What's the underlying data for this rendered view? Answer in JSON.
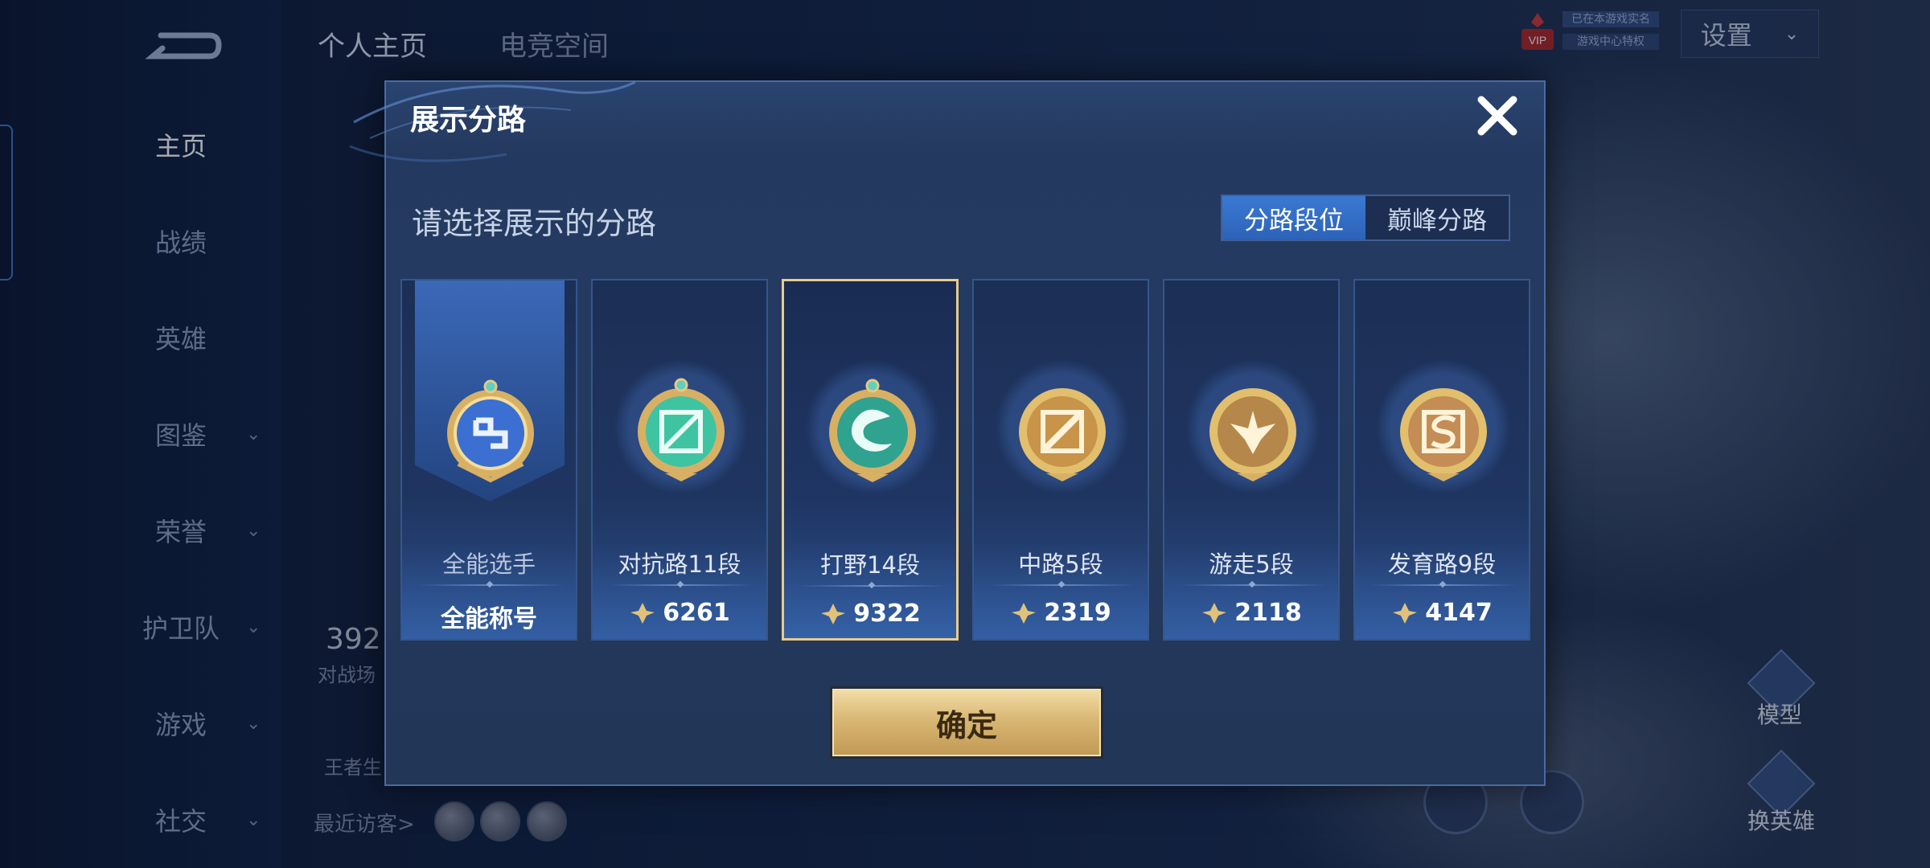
{
  "background": {
    "tabs": [
      "个人主页",
      "电竞空间"
    ],
    "settings_label": "设置",
    "vip_label": "VIP",
    "vip_line1": "已在本游戏实名",
    "vip_line2": "游戏中心特权",
    "nav_items": [
      {
        "label": "主页",
        "expandable": false
      },
      {
        "label": "战绩",
        "expandable": false
      },
      {
        "label": "英雄",
        "expandable": false
      },
      {
        "label": "图鉴",
        "expandable": true
      },
      {
        "label": "荣誉",
        "expandable": true
      },
      {
        "label": "护卫队",
        "expandable": true
      },
      {
        "label": "游戏",
        "expandable": true
      },
      {
        "label": "社交",
        "expandable": true
      }
    ],
    "stat_value": "392",
    "stat_label": "对战场",
    "small_label": "王者生",
    "visitors_label": "最近访客>",
    "right_buttons": [
      "模型",
      "换英雄"
    ]
  },
  "modal": {
    "title": "展示分路",
    "subtitle": "请选择展示的分路",
    "toggle": {
      "options": [
        "分路段位",
        "巅峰分路"
      ],
      "active_index": 0
    },
    "selected_index": 2,
    "cards": [
      {
        "name": "全能选手",
        "bottom": "全能称号",
        "icon": "all-round-medal-icon",
        "color": "#3b6fd1"
      },
      {
        "name": "对抗路11段",
        "bottom": "6261",
        "icon": "clash-lane-medal-icon",
        "color": "#3fc4a2"
      },
      {
        "name": "打野14段",
        "bottom": "9322",
        "icon": "jungle-dragon-medal-icon",
        "color": "#2fa38f"
      },
      {
        "name": "中路5段",
        "bottom": "2319",
        "icon": "mid-lane-medal-icon",
        "color": "#c7944a"
      },
      {
        "name": "游走5段",
        "bottom": "2118",
        "icon": "roam-medal-icon",
        "color": "#b5874a"
      },
      {
        "name": "发育路9段",
        "bottom": "4147",
        "icon": "farm-lane-medal-icon",
        "color": "#c38d55"
      }
    ],
    "confirm_label": "确定"
  },
  "colors": {
    "accent_blue": "#2d63b8",
    "selected_border": "#e9cb8a",
    "gold_button": "#d9b774"
  }
}
